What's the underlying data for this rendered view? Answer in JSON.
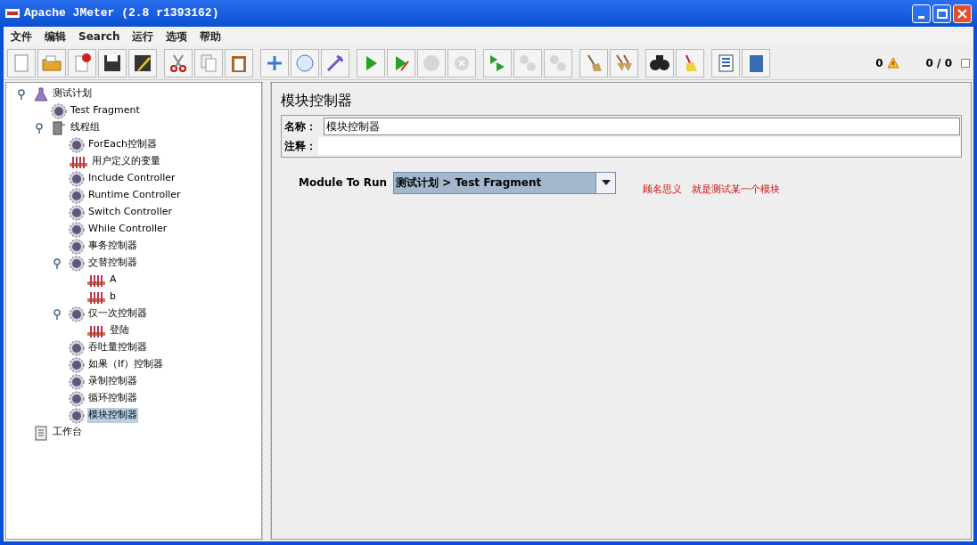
{
  "window": {
    "title": "Apache JMeter (2.8 r1393162)"
  },
  "menu": [
    "文件",
    "编辑",
    "Search",
    "运行",
    "选项",
    "帮助"
  ],
  "toolbar": [
    [
      {
        "kind": "new",
        "disabled": false
      },
      {
        "kind": "open",
        "disabled": false
      },
      {
        "kind": "close",
        "disabled": false
      },
      {
        "kind": "save",
        "disabled": false
      },
      {
        "kind": "save-as",
        "disabled": false
      }
    ],
    [
      {
        "kind": "cut",
        "disabled": false
      },
      {
        "kind": "copy",
        "disabled": false
      },
      {
        "kind": "paste",
        "disabled": false
      }
    ],
    [
      {
        "kind": "expand",
        "disabled": false
      },
      {
        "kind": "collapse",
        "disabled": false
      },
      {
        "kind": "toggle",
        "disabled": false
      }
    ],
    [
      {
        "kind": "start",
        "disabled": false
      },
      {
        "kind": "start-no-pause",
        "disabled": false
      },
      {
        "kind": "stop",
        "disabled": true
      },
      {
        "kind": "shutdown",
        "disabled": true
      }
    ],
    [
      {
        "kind": "remote-start",
        "disabled": false
      },
      {
        "kind": "remote-stop",
        "disabled": true
      },
      {
        "kind": "remote-exit",
        "disabled": true
      }
    ],
    [
      {
        "kind": "clear",
        "disabled": false
      },
      {
        "kind": "clear-all",
        "disabled": false
      }
    ],
    [
      {
        "kind": "search",
        "disabled": false
      },
      {
        "kind": "reset-search",
        "disabled": false
      }
    ],
    [
      {
        "kind": "function-helper",
        "disabled": false
      },
      {
        "kind": "help",
        "disabled": false
      }
    ]
  ],
  "status": {
    "errors": "0",
    "threads": "0 / 0",
    "checked": false
  },
  "tree": [
    {
      "label": "测试计划",
      "kind": "plan",
      "selected": false,
      "expanded": true,
      "children": [
        {
          "label": "Test Fragment",
          "kind": "controller",
          "selected": false
        },
        {
          "label": "线程组",
          "kind": "threadgroup",
          "selected": false,
          "expanded": true,
          "children": [
            {
              "label": "ForEach控制器",
              "kind": "controller",
              "selected": false
            },
            {
              "label": "用户定义的变量",
              "kind": "variables",
              "selected": false
            },
            {
              "label": "Include Controller",
              "kind": "controller",
              "selected": false
            },
            {
              "label": "Runtime Controller",
              "kind": "controller",
              "selected": false
            },
            {
              "label": "Switch Controller",
              "kind": "controller",
              "selected": false
            },
            {
              "label": "While Controller",
              "kind": "controller",
              "selected": false
            },
            {
              "label": "事务控制器",
              "kind": "controller",
              "selected": false
            },
            {
              "label": "交替控制器",
              "kind": "controller",
              "selected": false,
              "expanded": true,
              "children": [
                {
                  "label": "A",
                  "kind": "variables",
                  "selected": false
                },
                {
                  "label": "b",
                  "kind": "variables",
                  "selected": false
                }
              ]
            },
            {
              "label": "仅一次控制器",
              "kind": "controller",
              "selected": false,
              "expanded": true,
              "children": [
                {
                  "label": "登陆",
                  "kind": "variables",
                  "selected": false
                }
              ]
            },
            {
              "label": "吞吐量控制器",
              "kind": "controller",
              "selected": false
            },
            {
              "label": "如果（If）控制器",
              "kind": "controller",
              "selected": false
            },
            {
              "label": "录制控制器",
              "kind": "controller",
              "selected": false
            },
            {
              "label": "循环控制器",
              "kind": "controller",
              "selected": false
            },
            {
              "label": "模块控制器",
              "kind": "controller",
              "selected": true
            }
          ]
        }
      ]
    },
    {
      "label": "工作台",
      "kind": "workbench",
      "selected": false
    }
  ],
  "panel": {
    "title": "模块控制器",
    "name_label": "名称：",
    "name_value": "模块控制器",
    "comment_label": "注释：",
    "module_label": "Module To Run",
    "module_value": "测试计划 > Test Fragment",
    "note": "顾名思义　就是测试某一个模块"
  }
}
